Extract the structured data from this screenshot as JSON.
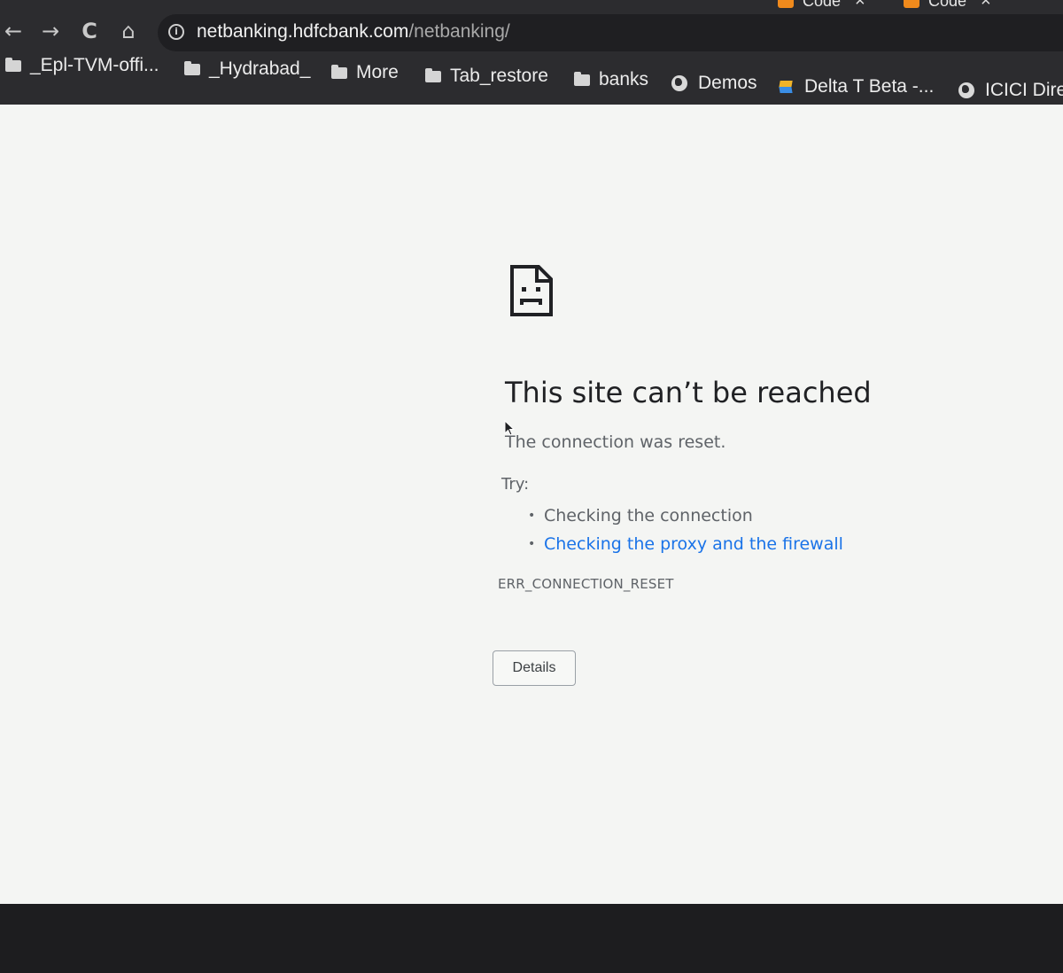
{
  "tabs": [
    {
      "label": "Code"
    },
    {
      "label": "Code"
    }
  ],
  "toolbar": {
    "back_icon": "←",
    "forward_icon": "→",
    "reload_icon": "C",
    "home_icon": "⌂"
  },
  "omnibox": {
    "info_icon": "i",
    "host": "netbanking.hdfcbank.com",
    "path": "/netbanking/"
  },
  "bookmarks": [
    {
      "label": "_Epl-TVM-offi...",
      "icon": "folder-icon"
    },
    {
      "label": "_Hydrabad_",
      "icon": "folder-icon"
    },
    {
      "label": "More",
      "icon": "folder-icon"
    },
    {
      "label": "Tab_restore",
      "icon": "folder-icon"
    },
    {
      "label": "banks",
      "icon": "folder-icon"
    },
    {
      "label": "Demos",
      "icon": "globe-icon"
    },
    {
      "label": "Delta T Beta -...",
      "icon": "stack-icon"
    },
    {
      "label": "ICICI Dire",
      "icon": "globe-icon"
    }
  ],
  "error": {
    "title": "This site can’t be reached",
    "description": "The connection was reset.",
    "try_label": "Try:",
    "suggestions": [
      {
        "text": "Checking the connection",
        "is_link": false
      },
      {
        "text": "Checking the proxy and the firewall",
        "is_link": true
      }
    ],
    "code": "ERR_CONNECTION_RESET",
    "details_label": "Details"
  },
  "colors": {
    "link": "#1a73e8",
    "page_background": "#f4f5f3",
    "chrome_background": "#2c2c2f"
  }
}
